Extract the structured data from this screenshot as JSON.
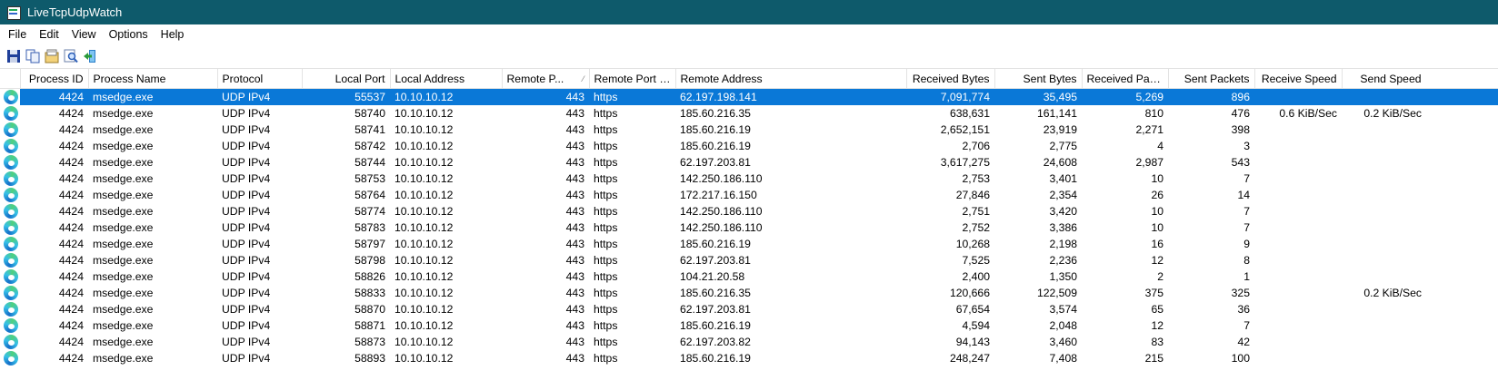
{
  "window": {
    "title": "LiveTcpUdpWatch"
  },
  "menu": [
    "File",
    "Edit",
    "View",
    "Options",
    "Help"
  ],
  "toolbar": [
    {
      "icon": "save-icon"
    },
    {
      "icon": "copy-icon"
    },
    {
      "icon": "properties-icon"
    },
    {
      "icon": "find-icon"
    },
    {
      "icon": "exit-icon"
    }
  ],
  "columns": [
    {
      "label": "Process ID"
    },
    {
      "label": "Process Name"
    },
    {
      "label": "Protocol"
    },
    {
      "label": "Local Port"
    },
    {
      "label": "Local Address"
    },
    {
      "label": "Remote P..."
    },
    {
      "label": "Remote Port N..."
    },
    {
      "label": "Remote Address"
    },
    {
      "label": "Received Bytes"
    },
    {
      "label": "Sent Bytes"
    },
    {
      "label": "Received Pack..."
    },
    {
      "label": "Sent Packets"
    },
    {
      "label": "Receive Speed"
    },
    {
      "label": "Send Speed"
    }
  ],
  "sort_indicator": "⁄",
  "rows": [
    [
      "4424",
      "msedge.exe",
      "UDP IPv4",
      "55537",
      "10.10.10.12",
      "443",
      "https",
      "62.197.198.141",
      "7,091,774",
      "35,495",
      "5,269",
      "896",
      "",
      ""
    ],
    [
      "4424",
      "msedge.exe",
      "UDP IPv4",
      "58740",
      "10.10.10.12",
      "443",
      "https",
      "185.60.216.35",
      "638,631",
      "161,141",
      "810",
      "476",
      "0.6 KiB/Sec",
      "0.2 KiB/Sec"
    ],
    [
      "4424",
      "msedge.exe",
      "UDP IPv4",
      "58741",
      "10.10.10.12",
      "443",
      "https",
      "185.60.216.19",
      "2,652,151",
      "23,919",
      "2,271",
      "398",
      "",
      ""
    ],
    [
      "4424",
      "msedge.exe",
      "UDP IPv4",
      "58742",
      "10.10.10.12",
      "443",
      "https",
      "185.60.216.19",
      "2,706",
      "2,775",
      "4",
      "3",
      "",
      ""
    ],
    [
      "4424",
      "msedge.exe",
      "UDP IPv4",
      "58744",
      "10.10.10.12",
      "443",
      "https",
      "62.197.203.81",
      "3,617,275",
      "24,608",
      "2,987",
      "543",
      "",
      ""
    ],
    [
      "4424",
      "msedge.exe",
      "UDP IPv4",
      "58753",
      "10.10.10.12",
      "443",
      "https",
      "142.250.186.110",
      "2,753",
      "3,401",
      "10",
      "7",
      "",
      ""
    ],
    [
      "4424",
      "msedge.exe",
      "UDP IPv4",
      "58764",
      "10.10.10.12",
      "443",
      "https",
      "172.217.16.150",
      "27,846",
      "2,354",
      "26",
      "14",
      "",
      ""
    ],
    [
      "4424",
      "msedge.exe",
      "UDP IPv4",
      "58774",
      "10.10.10.12",
      "443",
      "https",
      "142.250.186.110",
      "2,751",
      "3,420",
      "10",
      "7",
      "",
      ""
    ],
    [
      "4424",
      "msedge.exe",
      "UDP IPv4",
      "58783",
      "10.10.10.12",
      "443",
      "https",
      "142.250.186.110",
      "2,752",
      "3,386",
      "10",
      "7",
      "",
      ""
    ],
    [
      "4424",
      "msedge.exe",
      "UDP IPv4",
      "58797",
      "10.10.10.12",
      "443",
      "https",
      "185.60.216.19",
      "10,268",
      "2,198",
      "16",
      "9",
      "",
      ""
    ],
    [
      "4424",
      "msedge.exe",
      "UDP IPv4",
      "58798",
      "10.10.10.12",
      "443",
      "https",
      "62.197.203.81",
      "7,525",
      "2,236",
      "12",
      "8",
      "",
      ""
    ],
    [
      "4424",
      "msedge.exe",
      "UDP IPv4",
      "58826",
      "10.10.10.12",
      "443",
      "https",
      "104.21.20.58",
      "2,400",
      "1,350",
      "2",
      "1",
      "",
      ""
    ],
    [
      "4424",
      "msedge.exe",
      "UDP IPv4",
      "58833",
      "10.10.10.12",
      "443",
      "https",
      "185.60.216.35",
      "120,666",
      "122,509",
      "375",
      "325",
      "",
      "0.2 KiB/Sec"
    ],
    [
      "4424",
      "msedge.exe",
      "UDP IPv4",
      "58870",
      "10.10.10.12",
      "443",
      "https",
      "62.197.203.81",
      "67,654",
      "3,574",
      "65",
      "36",
      "",
      ""
    ],
    [
      "4424",
      "msedge.exe",
      "UDP IPv4",
      "58871",
      "10.10.10.12",
      "443",
      "https",
      "185.60.216.19",
      "4,594",
      "2,048",
      "12",
      "7",
      "",
      ""
    ],
    [
      "4424",
      "msedge.exe",
      "UDP IPv4",
      "58873",
      "10.10.10.12",
      "443",
      "https",
      "62.197.203.82",
      "94,143",
      "3,460",
      "83",
      "42",
      "",
      ""
    ],
    [
      "4424",
      "msedge.exe",
      "UDP IPv4",
      "58893",
      "10.10.10.12",
      "443",
      "https",
      "185.60.216.19",
      "248,247",
      "7,408",
      "215",
      "100",
      "",
      ""
    ]
  ],
  "selected_row": 0,
  "row_icon": "edge-browser-icon",
  "colors": {
    "titlebar": "#0e5a6b",
    "selection": "#0a78d7"
  }
}
